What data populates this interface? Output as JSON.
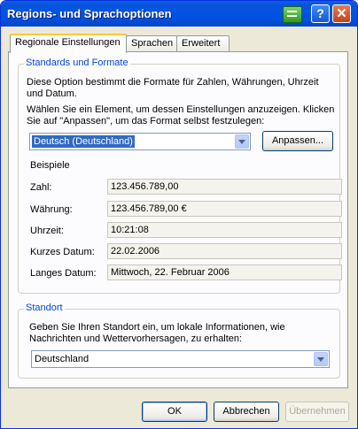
{
  "window": {
    "title": "Regions- und Sprachoptionen",
    "help_glyph": "?",
    "close_glyph": "✕"
  },
  "tabs": [
    "Regionale Einstellungen",
    "Sprachen",
    "Erweitert"
  ],
  "standards": {
    "title": "Standards und Formate",
    "description": "Diese Option bestimmt die Formate für Zahlen, Währungen, Uhrzeit und Datum.",
    "instruction": "Wählen Sie ein Element, um dessen Einstellungen anzuzeigen. Klicken Sie auf \"Anpassen\", um das Format selbst festzulegen:",
    "locale_value": "Deutsch (Deutschland)",
    "customize_label": "Anpassen...",
    "examples_label": "Beispiele",
    "examples": [
      {
        "label": "Zahl:",
        "value": "123.456.789,00"
      },
      {
        "label": "Währung:",
        "value": "123.456.789,00 €"
      },
      {
        "label": "Uhrzeit:",
        "value": "10:21:08"
      },
      {
        "label": "Kurzes Datum:",
        "value": "22.02.2006"
      },
      {
        "label": "Langes Datum:",
        "value": "Mittwoch, 22. Februar 2006"
      }
    ]
  },
  "location": {
    "title": "Standort",
    "description": "Geben Sie Ihren Standort ein, um lokale Informationen, wie Nachrichten und Wettervorhersagen, zu erhalten:",
    "value": "Deutschland"
  },
  "buttons": {
    "ok": "OK",
    "cancel": "Abbrechen",
    "apply": "Übernehmen"
  }
}
